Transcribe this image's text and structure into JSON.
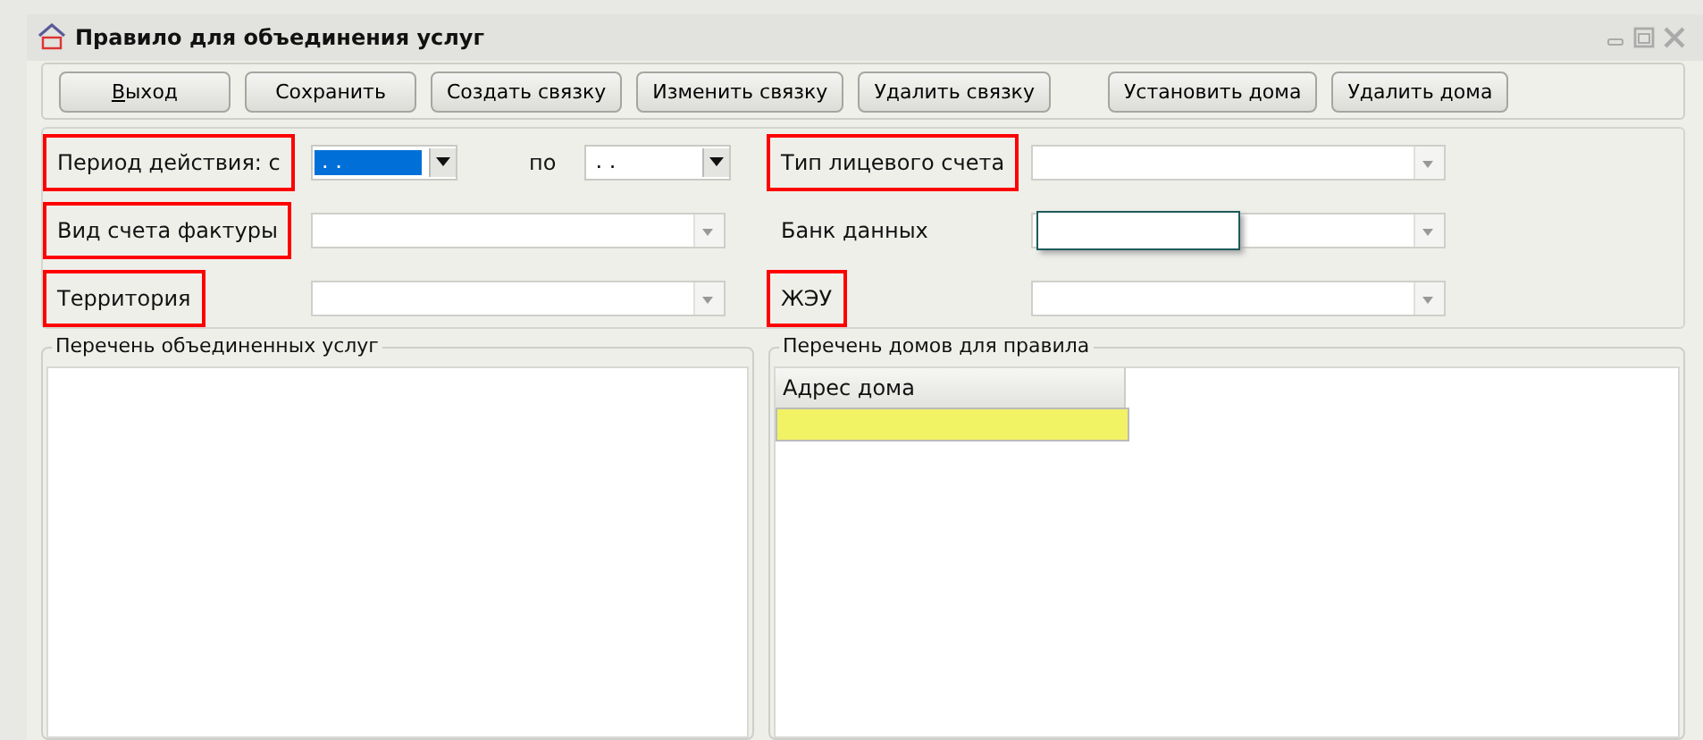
{
  "window": {
    "title": "Правило для объединения услуг"
  },
  "toolbar": [
    {
      "label": "Выход",
      "underline_first": true
    },
    {
      "label": "Сохранить",
      "underline_first": false
    },
    {
      "label": "Создать связку",
      "underline_first": false
    },
    {
      "label": "Изменить связку",
      "underline_first": false
    },
    {
      "label": "Удалить связку",
      "underline_first": false
    },
    {
      "label": "Установить дома",
      "underline_first": false
    },
    {
      "label": "Удалить дома",
      "underline_first": false
    }
  ],
  "filters": {
    "period": {
      "label": "Период действия: с",
      "highlighted": true,
      "to_label": "по",
      "from": {
        "value": ". .",
        "selected": true
      },
      "to": {
        "value": ". .",
        "selected": false
      }
    },
    "fields": [
      {
        "label": "Тип лицевого счета",
        "highlighted": true,
        "focused": false
      },
      {
        "label": "Вид счета фактуры",
        "highlighted": true,
        "focused": false
      },
      {
        "label": "Банк данных",
        "highlighted": false,
        "focused": true
      },
      {
        "label": "Территория",
        "highlighted": true,
        "focused": false
      },
      {
        "label": "ЖЭУ",
        "highlighted": true,
        "focused": false
      }
    ]
  },
  "services_group": {
    "title": "Перечень объединенных услуг"
  },
  "houses_group": {
    "title": "Перечень домов для правила",
    "table": {
      "columns": [
        "Адрес дома"
      ],
      "rows": [
        {
          "selected": true
        }
      ]
    }
  }
}
